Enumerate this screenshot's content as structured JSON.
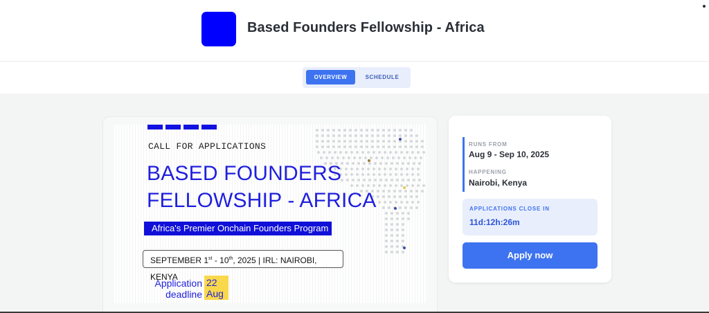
{
  "header": {
    "title": "Based Founders Fellowship - Africa",
    "logo_color": "#0000ff"
  },
  "tabs": [
    {
      "label": "OVERVIEW",
      "active": true
    },
    {
      "label": "SCHEDULE",
      "active": false
    }
  ],
  "banner": {
    "kicker": "CALL FOR APPLICATIONS",
    "title_line1": "BASED FOUNDERS",
    "title_line2": "FELLOWSHIP - AFRICA",
    "subtitle": "Africa's Premier Onchain Founders Program",
    "dates_pre": "SEPTEMBER 1",
    "dates_sup1": "st",
    "dates_mid": " - 10",
    "dates_sup2": "th",
    "dates_post": ", 2025 | IRL: NAIROBI, KENYA",
    "deadline_label_1": "Application",
    "deadline_label_2": "deadline",
    "deadline_day": "22",
    "deadline_month": "Aug"
  },
  "sidebar": {
    "runs_from_label": "RUNS FROM",
    "runs_from_value": "Aug 9 - Sep 10, 2025",
    "happening_label": "HAPPENING",
    "happening_value": "Nairobi, Kenya",
    "applications_close_label": "APPLICATIONS CLOSE IN",
    "countdown": "11d:12h:26m",
    "apply_label": "Apply now"
  },
  "colors": {
    "accent": "#3d73f0",
    "brand_blue": "#1f1fdd",
    "highlight_yellow": "#f9d84b"
  }
}
